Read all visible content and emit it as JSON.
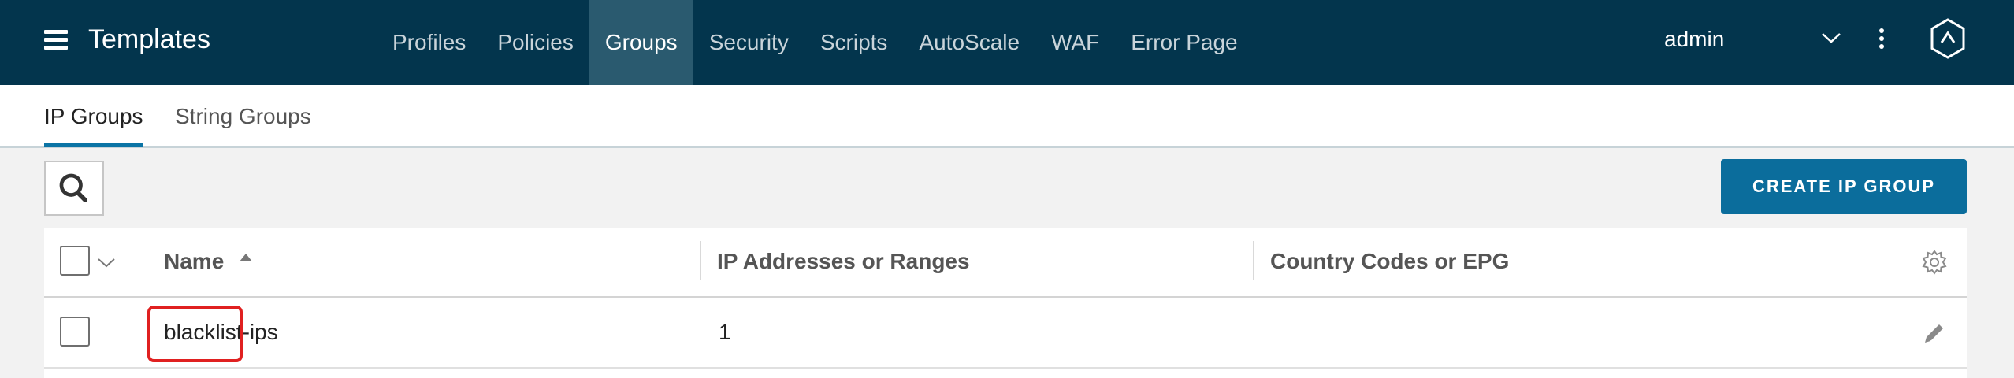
{
  "header": {
    "app_title": "Templates",
    "menu_icon": "hamburger-menu-icon",
    "nav": [
      {
        "label": "Profiles",
        "active": false
      },
      {
        "label": "Policies",
        "active": false
      },
      {
        "label": "Groups",
        "active": true
      },
      {
        "label": "Security",
        "active": false
      },
      {
        "label": "Scripts",
        "active": false
      },
      {
        "label": "AutoScale",
        "active": false
      },
      {
        "label": "WAF",
        "active": false
      },
      {
        "label": "Error Page",
        "active": false
      }
    ],
    "user": "admin",
    "icons": [
      "chevron-down-icon",
      "kebab-menu-icon",
      "brand-logo-icon"
    ]
  },
  "subtabs": {
    "items": [
      {
        "label": "IP Groups",
        "active": true
      },
      {
        "label": "String Groups",
        "active": false
      }
    ]
  },
  "toolbar": {
    "search_icon": "search-icon",
    "create_label": "CREATE IP GROUP"
  },
  "table": {
    "columns": [
      "Name",
      "IP Addresses or Ranges",
      "Country Codes or EPG"
    ],
    "sort": {
      "column": "Name",
      "direction": "ascending"
    },
    "rows": [
      {
        "name": "blacklist-ips",
        "ip_count": "1",
        "country_codes": ""
      }
    ]
  },
  "colors": {
    "header_bg": "#03354d",
    "active_nav_bg": "#2a5a6f",
    "accent": "#0b6d9c",
    "highlight": "#e02020"
  }
}
